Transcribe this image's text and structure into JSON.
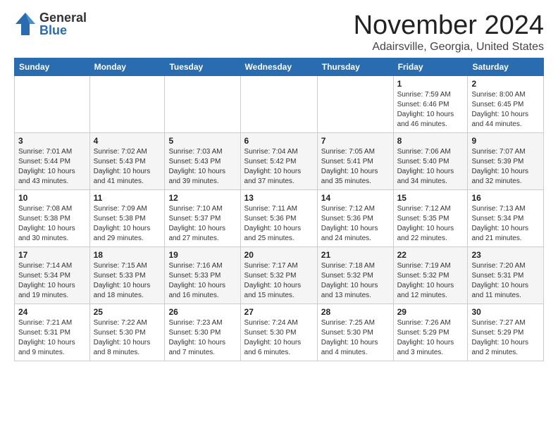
{
  "header": {
    "logo_general": "General",
    "logo_blue": "Blue",
    "month": "November 2024",
    "location": "Adairsville, Georgia, United States"
  },
  "weekdays": [
    "Sunday",
    "Monday",
    "Tuesday",
    "Wednesday",
    "Thursday",
    "Friday",
    "Saturday"
  ],
  "weeks": [
    [
      {
        "day": "",
        "info": ""
      },
      {
        "day": "",
        "info": ""
      },
      {
        "day": "",
        "info": ""
      },
      {
        "day": "",
        "info": ""
      },
      {
        "day": "",
        "info": ""
      },
      {
        "day": "1",
        "info": "Sunrise: 7:59 AM\nSunset: 6:46 PM\nDaylight: 10 hours\nand 46 minutes."
      },
      {
        "day": "2",
        "info": "Sunrise: 8:00 AM\nSunset: 6:45 PM\nDaylight: 10 hours\nand 44 minutes."
      }
    ],
    [
      {
        "day": "3",
        "info": "Sunrise: 7:01 AM\nSunset: 5:44 PM\nDaylight: 10 hours\nand 43 minutes."
      },
      {
        "day": "4",
        "info": "Sunrise: 7:02 AM\nSunset: 5:43 PM\nDaylight: 10 hours\nand 41 minutes."
      },
      {
        "day": "5",
        "info": "Sunrise: 7:03 AM\nSunset: 5:43 PM\nDaylight: 10 hours\nand 39 minutes."
      },
      {
        "day": "6",
        "info": "Sunrise: 7:04 AM\nSunset: 5:42 PM\nDaylight: 10 hours\nand 37 minutes."
      },
      {
        "day": "7",
        "info": "Sunrise: 7:05 AM\nSunset: 5:41 PM\nDaylight: 10 hours\nand 35 minutes."
      },
      {
        "day": "8",
        "info": "Sunrise: 7:06 AM\nSunset: 5:40 PM\nDaylight: 10 hours\nand 34 minutes."
      },
      {
        "day": "9",
        "info": "Sunrise: 7:07 AM\nSunset: 5:39 PM\nDaylight: 10 hours\nand 32 minutes."
      }
    ],
    [
      {
        "day": "10",
        "info": "Sunrise: 7:08 AM\nSunset: 5:38 PM\nDaylight: 10 hours\nand 30 minutes."
      },
      {
        "day": "11",
        "info": "Sunrise: 7:09 AM\nSunset: 5:38 PM\nDaylight: 10 hours\nand 29 minutes."
      },
      {
        "day": "12",
        "info": "Sunrise: 7:10 AM\nSunset: 5:37 PM\nDaylight: 10 hours\nand 27 minutes."
      },
      {
        "day": "13",
        "info": "Sunrise: 7:11 AM\nSunset: 5:36 PM\nDaylight: 10 hours\nand 25 minutes."
      },
      {
        "day": "14",
        "info": "Sunrise: 7:12 AM\nSunset: 5:36 PM\nDaylight: 10 hours\nand 24 minutes."
      },
      {
        "day": "15",
        "info": "Sunrise: 7:12 AM\nSunset: 5:35 PM\nDaylight: 10 hours\nand 22 minutes."
      },
      {
        "day": "16",
        "info": "Sunrise: 7:13 AM\nSunset: 5:34 PM\nDaylight: 10 hours\nand 21 minutes."
      }
    ],
    [
      {
        "day": "17",
        "info": "Sunrise: 7:14 AM\nSunset: 5:34 PM\nDaylight: 10 hours\nand 19 minutes."
      },
      {
        "day": "18",
        "info": "Sunrise: 7:15 AM\nSunset: 5:33 PM\nDaylight: 10 hours\nand 18 minutes."
      },
      {
        "day": "19",
        "info": "Sunrise: 7:16 AM\nSunset: 5:33 PM\nDaylight: 10 hours\nand 16 minutes."
      },
      {
        "day": "20",
        "info": "Sunrise: 7:17 AM\nSunset: 5:32 PM\nDaylight: 10 hours\nand 15 minutes."
      },
      {
        "day": "21",
        "info": "Sunrise: 7:18 AM\nSunset: 5:32 PM\nDaylight: 10 hours\nand 13 minutes."
      },
      {
        "day": "22",
        "info": "Sunrise: 7:19 AM\nSunset: 5:32 PM\nDaylight: 10 hours\nand 12 minutes."
      },
      {
        "day": "23",
        "info": "Sunrise: 7:20 AM\nSunset: 5:31 PM\nDaylight: 10 hours\nand 11 minutes."
      }
    ],
    [
      {
        "day": "24",
        "info": "Sunrise: 7:21 AM\nSunset: 5:31 PM\nDaylight: 10 hours\nand 9 minutes."
      },
      {
        "day": "25",
        "info": "Sunrise: 7:22 AM\nSunset: 5:30 PM\nDaylight: 10 hours\nand 8 minutes."
      },
      {
        "day": "26",
        "info": "Sunrise: 7:23 AM\nSunset: 5:30 PM\nDaylight: 10 hours\nand 7 minutes."
      },
      {
        "day": "27",
        "info": "Sunrise: 7:24 AM\nSunset: 5:30 PM\nDaylight: 10 hours\nand 6 minutes."
      },
      {
        "day": "28",
        "info": "Sunrise: 7:25 AM\nSunset: 5:30 PM\nDaylight: 10 hours\nand 4 minutes."
      },
      {
        "day": "29",
        "info": "Sunrise: 7:26 AM\nSunset: 5:29 PM\nDaylight: 10 hours\nand 3 minutes."
      },
      {
        "day": "30",
        "info": "Sunrise: 7:27 AM\nSunset: 5:29 PM\nDaylight: 10 hours\nand 2 minutes."
      }
    ]
  ]
}
